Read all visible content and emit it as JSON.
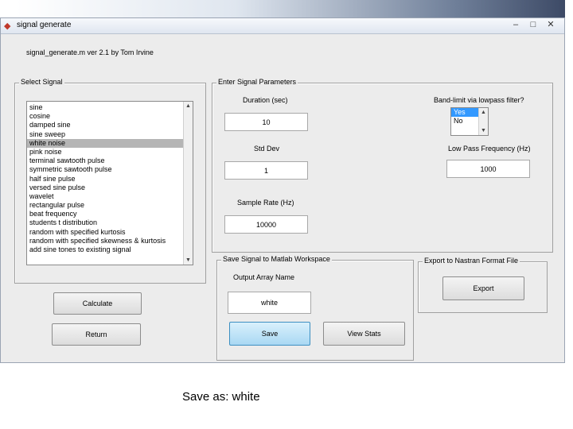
{
  "window": {
    "title": "signal generate",
    "header": "signal_generate.m   ver 2.1   by Tom Irvine"
  },
  "select_signal": {
    "title": "Select Signal",
    "items": [
      "sine",
      "cosine",
      "damped sine",
      "sine sweep",
      "white noise",
      "pink noise",
      "terminal sawtooth pulse",
      "symmetric sawtooth pulse",
      "half sine pulse",
      "versed sine pulse",
      "wavelet",
      "rectangular pulse",
      "beat frequency",
      "students t distribution",
      "random with specified kurtosis",
      "random with specified skewness & kurtosis",
      "add sine tones to existing signal"
    ],
    "selected_index": 4
  },
  "parameters": {
    "title": "Enter Signal Parameters",
    "duration_label": "Duration (sec)",
    "duration_value": "10",
    "std_dev_label": "Std Dev",
    "std_dev_value": "1",
    "sample_rate_label": "Sample Rate (Hz)",
    "sample_rate_value": "10000",
    "bandlimit_label": "Band-limit via lowpass filter?",
    "bandlimit_options": [
      "Yes",
      "No"
    ],
    "bandlimit_selected_index": 0,
    "lowpass_label": "Low Pass Frequency (Hz)",
    "lowpass_value": "1000"
  },
  "save_panel": {
    "title": "Save Signal to Matlab Workspace",
    "output_label": "Output Array Name",
    "output_value": "white",
    "save_label": "Save",
    "view_stats_label": "View Stats"
  },
  "export_panel": {
    "title": "Export to Nastran Format File",
    "export_label": "Export"
  },
  "buttons": {
    "calculate_label": "Calculate",
    "return_label": "Return"
  },
  "caption": "Save as:  white"
}
